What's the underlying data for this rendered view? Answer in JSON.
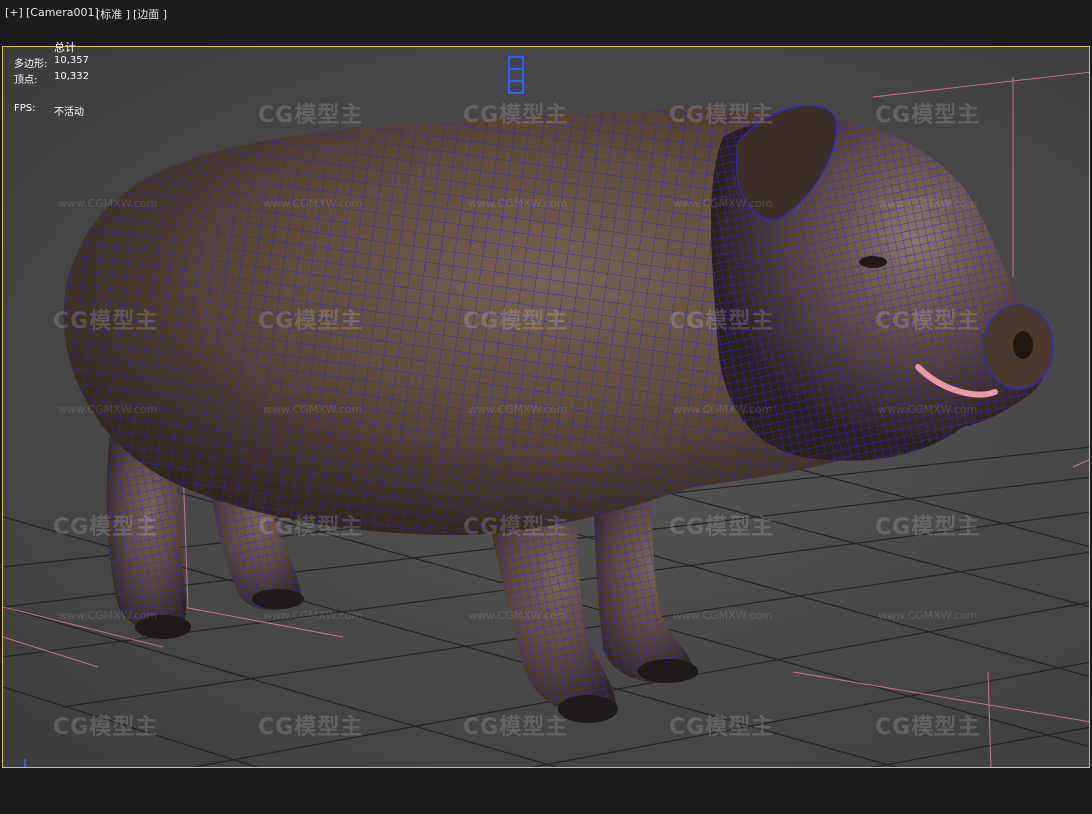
{
  "viewport_labels": {
    "plus": "[+]",
    "camera": "[Camera001]",
    "shading": "[标准 ]",
    "edges": "[边面 ]"
  },
  "stats": {
    "header": "总计",
    "polys_label": "多边形:",
    "polys_value": "10,357",
    "verts_label": "顶点:",
    "verts_value": "10,332",
    "fps_label": "FPS:",
    "fps_value": "不活动"
  },
  "watermark": {
    "logo_text": "CG模型主",
    "url_text": "www.CGMXW.com"
  },
  "colors": {
    "viewport_border": "#d8c640",
    "wireframe": "#2a2ad0",
    "model_base": "#5a4536",
    "grid_line": "#222222"
  }
}
